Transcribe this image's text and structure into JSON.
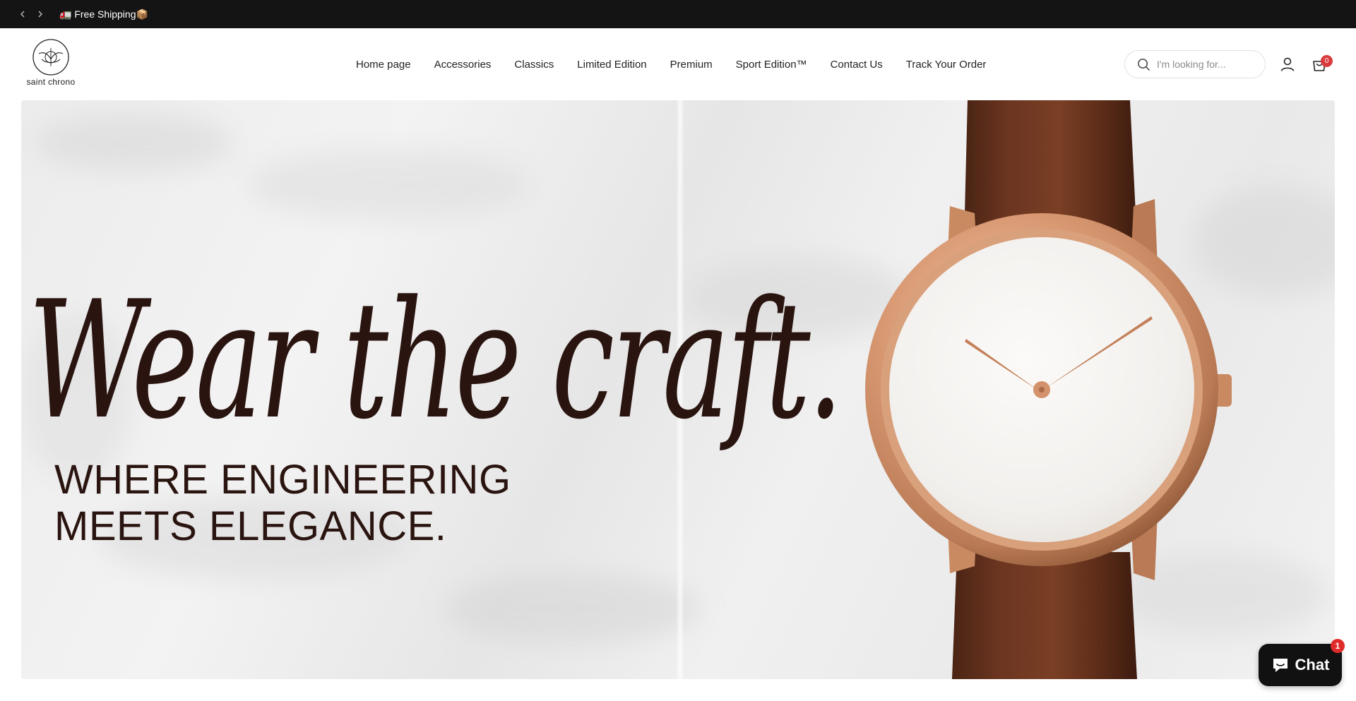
{
  "announcement": {
    "prev_icon": "chevron-left-icon",
    "next_icon": "chevron-right-icon",
    "message": "🚛 Free Shipping📦"
  },
  "header": {
    "logo_text": "saint chrono",
    "nav": [
      {
        "label": "Home page"
      },
      {
        "label": "Accessories"
      },
      {
        "label": "Classics"
      },
      {
        "label": "Limited Edition"
      },
      {
        "label": "Premium"
      },
      {
        "label": "Sport Edition™"
      },
      {
        "label": "Contact Us"
      },
      {
        "label": "Track Your Order"
      }
    ],
    "search": {
      "placeholder": "I'm looking for...",
      "icon": "search-icon"
    },
    "account_icon": "user-icon",
    "cart": {
      "icon": "cart-icon",
      "count": "0"
    }
  },
  "hero": {
    "script_heading": "Wear the craft.",
    "tagline_line1": "WHERE ENGINEERING",
    "tagline_line2": "MEETS ELEGANCE."
  },
  "chat": {
    "label": "Chat",
    "badge": "1",
    "icon": "chat-bubble-icon"
  },
  "colors": {
    "announcement_bg": "#141414",
    "hero_text": "#2a1410",
    "cart_badge": "#d83b3b",
    "chat_bg": "#111111"
  }
}
